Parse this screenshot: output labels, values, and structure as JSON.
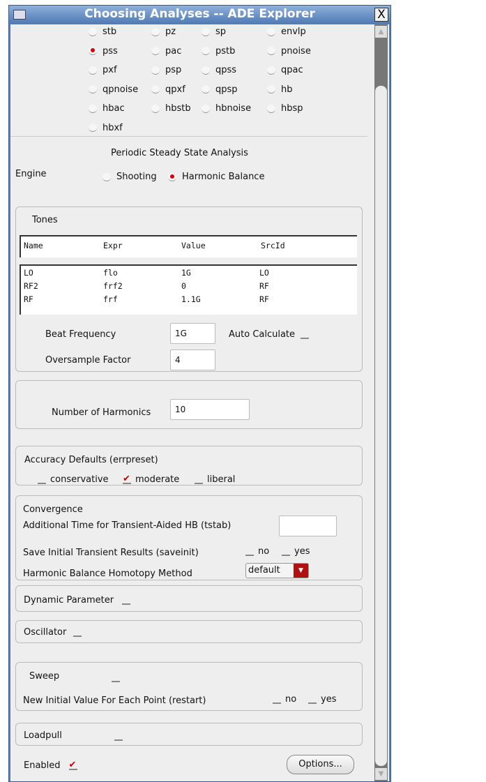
{
  "window": {
    "title": "Choosing Analyses -- ADE Explorer",
    "close": "X"
  },
  "analyses": [
    [
      "stb",
      "pz",
      "sp",
      "envlp"
    ],
    [
      "pss",
      "pac",
      "pstb",
      "pnoise"
    ],
    [
      "pxf",
      "psp",
      "qpss",
      "qpac"
    ],
    [
      "qpnoise",
      "qpxf",
      "qpsp",
      "hb"
    ],
    [
      "hbac",
      "hbstb",
      "hbnoise",
      "hbsp"
    ],
    [
      "hbxf"
    ]
  ],
  "selected_analysis": "pss",
  "section_title": "Periodic Steady State Analysis",
  "engine": {
    "label": "Engine",
    "options": [
      "Shooting",
      "Harmonic Balance"
    ],
    "selected": "Harmonic Balance"
  },
  "tones": {
    "label": "Tones",
    "headers": [
      "Name",
      "Expr",
      "Value",
      "SrcId"
    ],
    "rows": [
      [
        "LO",
        "flo",
        "1G",
        "LO"
      ],
      [
        "RF2",
        "frf2",
        "0",
        "RF"
      ],
      [
        "RF",
        "frf",
        "1.1G",
        "RF"
      ]
    ],
    "beat_label": "Beat Frequency",
    "beat_value": "1G",
    "auto_label": "Auto Calculate",
    "oversample_label": "Oversample Factor",
    "oversample_value": "4"
  },
  "harmonics": {
    "label": "Number of Harmonics",
    "value": "10"
  },
  "accuracy": {
    "label": "Accuracy Defaults (errpreset)",
    "options": [
      "conservative",
      "moderate",
      "liberal"
    ],
    "selected": "moderate"
  },
  "convergence": {
    "label": "Convergence",
    "tstab_label": "Additional Time for Transient-Aided HB (tstab)",
    "tstab_value": "",
    "saveinit_label": "Save Initial Transient Results (saveinit)",
    "no": "no",
    "yes": "yes",
    "homotopy_label": "Harmonic Balance Homotopy Method",
    "homotopy_value": "default"
  },
  "dynamic": "Dynamic Parameter",
  "oscillator": "Oscillator",
  "sweep": {
    "label": "Sweep",
    "restart_label": "New Initial Value For Each Point (restart)",
    "no": "no",
    "yes": "yes"
  },
  "loadpull": "Loadpull",
  "enabled": "Enabled",
  "options_button": "Options..."
}
